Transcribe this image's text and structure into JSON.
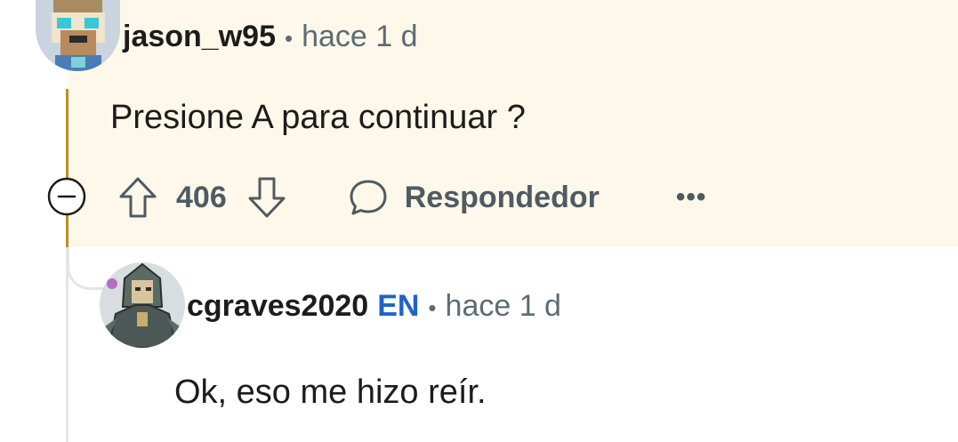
{
  "comment": {
    "username": "jason_w95",
    "separator": "•",
    "time": "hace 1 d",
    "body": "Presione A para continuar ?",
    "votes": "406",
    "reply_label": "Respondedor",
    "more_label": "•••",
    "avatar_icon": "pixel-character-avatar-icon"
  },
  "reply": {
    "username": "cgraves2020",
    "flair": "EN",
    "separator": "•",
    "time": "hace 1 d",
    "body": "Ok, eso me hizo reír.",
    "avatar_icon": "armored-character-avatar-icon"
  },
  "colors": {
    "highlight_bg": "#fdf8ea",
    "thread_gold": "#b8911e",
    "flair_blue": "#1f62c7",
    "meta_grey": "#5c6c74"
  }
}
